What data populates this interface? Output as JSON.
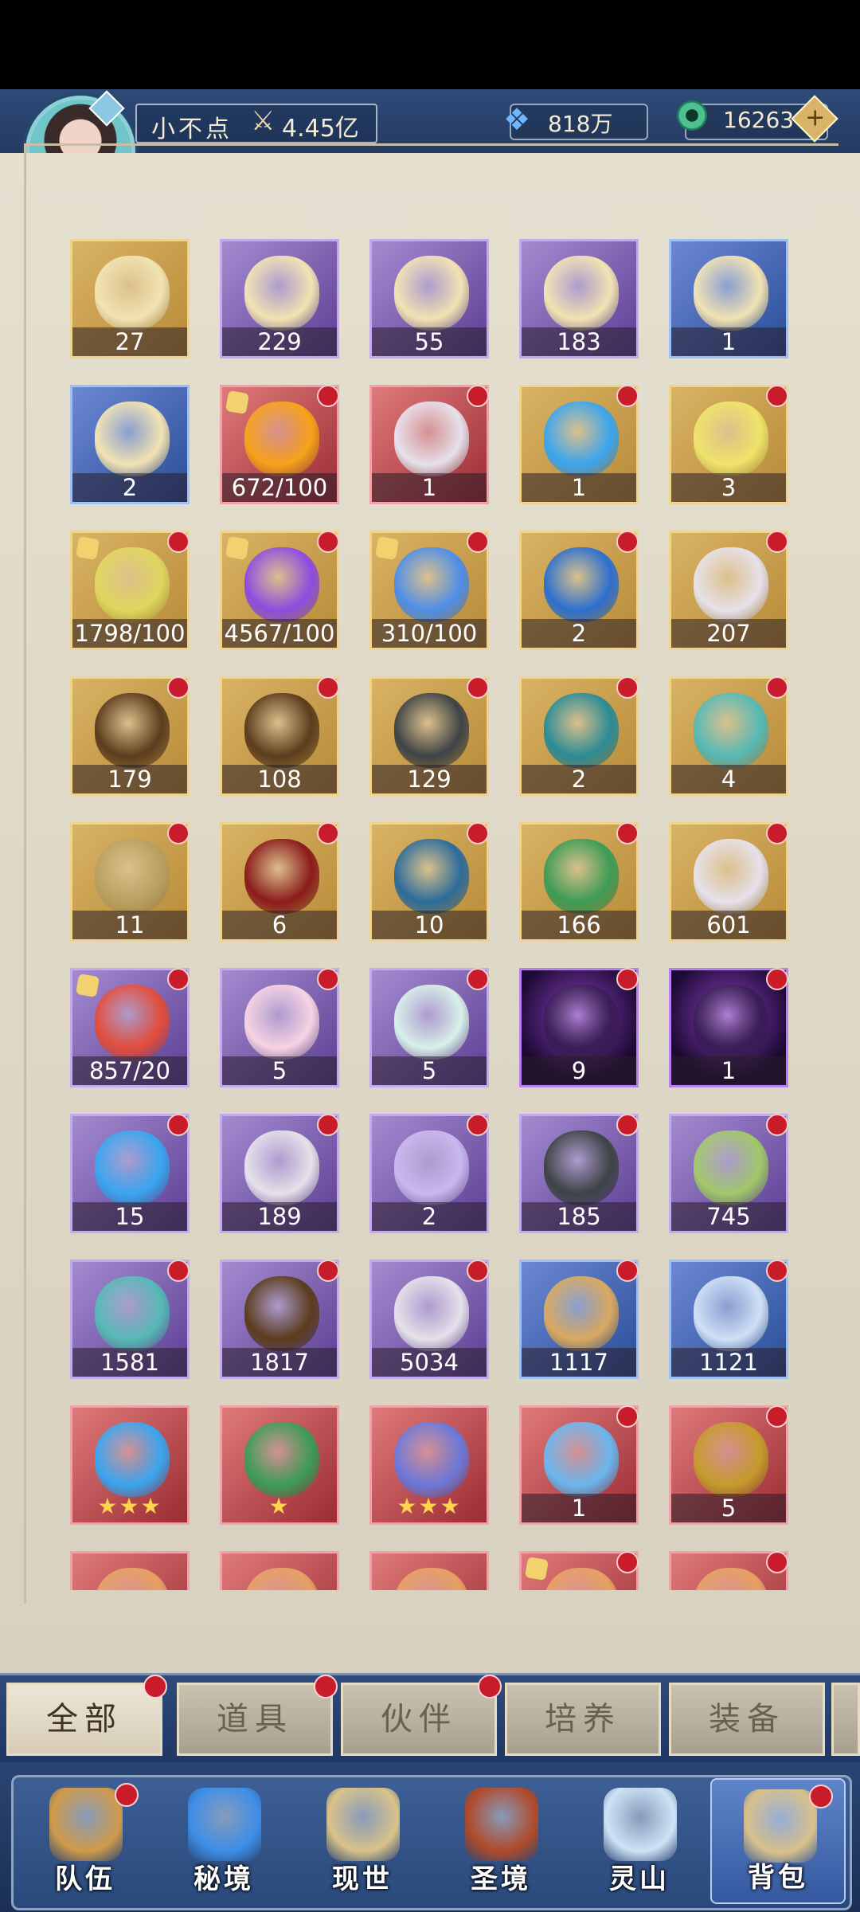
{
  "header": {
    "player_name": "小不点",
    "power_value": "4.45亿",
    "resource_1_value": "818万",
    "resource_2_value": "16263",
    "plus_symbol": "+"
  },
  "inventory": {
    "rows": [
      [
        {
          "count": "27",
          "style": "gold",
          "art": "#f2e3b3",
          "dot": false,
          "piece": false
        },
        {
          "count": "229",
          "style": "purple",
          "art": "#f2e3b3",
          "dot": false,
          "piece": false
        },
        {
          "count": "55",
          "style": "purple",
          "art": "#f2e3b3",
          "dot": false,
          "piece": false
        },
        {
          "count": "183",
          "style": "purple",
          "art": "#f2e3b3",
          "dot": false,
          "piece": false
        },
        {
          "count": "1",
          "style": "blue",
          "art": "#f2e3b3",
          "dot": false,
          "piece": false
        }
      ],
      [
        {
          "count": "2",
          "style": "blue",
          "art": "#f2e3b3",
          "dot": false,
          "piece": false
        },
        {
          "count": "672/100",
          "style": "red",
          "art": "#f6a21a",
          "dot": true,
          "piece": true
        },
        {
          "count": "1",
          "style": "red",
          "art": "#e6e1ea",
          "dot": true,
          "piece": false
        },
        {
          "count": "1",
          "style": "gold",
          "art": "#3aa5ef",
          "dot": true,
          "piece": false
        },
        {
          "count": "3",
          "style": "gold",
          "art": "#efe36a",
          "dot": true,
          "piece": false
        }
      ],
      [
        {
          "count": "1798/100",
          "style": "gold",
          "art": "#e0d65e",
          "dot": true,
          "piece": true
        },
        {
          "count": "4567/100",
          "style": "gold",
          "art": "#8e4ce0",
          "dot": true,
          "piece": true
        },
        {
          "count": "310/100",
          "style": "gold",
          "art": "#4e8ee8",
          "dot": true,
          "piece": true
        },
        {
          "count": "2",
          "style": "gold",
          "art": "#2c70cf",
          "dot": true,
          "piece": false
        },
        {
          "count": "207",
          "style": "gold",
          "art": "#e6e1ea",
          "dot": true,
          "piece": false
        }
      ],
      [
        {
          "count": "179",
          "style": "gold",
          "art": "#5b3c1d",
          "dot": true,
          "piece": false
        },
        {
          "count": "108",
          "style": "gold",
          "art": "#5b3c1d",
          "dot": true,
          "piece": false
        },
        {
          "count": "129",
          "style": "gold",
          "art": "#3e4346",
          "dot": true,
          "piece": false
        },
        {
          "count": "2",
          "style": "gold",
          "art": "#2b8b96",
          "dot": true,
          "piece": false
        },
        {
          "count": "4",
          "style": "gold",
          "art": "#56b9b6",
          "dot": true,
          "piece": false
        }
      ],
      [
        {
          "count": "11",
          "style": "gold",
          "art": "#b9a061",
          "dot": true,
          "piece": false
        },
        {
          "count": "6",
          "style": "gold",
          "art": "#8b1b1b",
          "dot": true,
          "piece": false
        },
        {
          "count": "10",
          "style": "gold",
          "art": "#2c6c9b",
          "dot": true,
          "piece": false
        },
        {
          "count": "166",
          "style": "gold",
          "art": "#3c9c55",
          "dot": true,
          "piece": false
        },
        {
          "count": "601",
          "style": "gold",
          "art": "#e6e1ea",
          "dot": true,
          "piece": false
        }
      ],
      [
        {
          "count": "857/20",
          "style": "purple",
          "art": "#e24d3b",
          "dot": true,
          "piece": true
        },
        {
          "count": "5",
          "style": "purple",
          "art": "#f7d3e3",
          "dot": true,
          "piece": false
        },
        {
          "count": "5",
          "style": "purple",
          "art": "#d8f0ea",
          "dot": true,
          "piece": false
        },
        {
          "count": "9",
          "style": "dark",
          "art": "#3b1d59",
          "dot": true,
          "piece": false
        },
        {
          "count": "1",
          "style": "dark",
          "art": "#3b1d59",
          "dot": true,
          "piece": false
        }
      ],
      [
        {
          "count": "15",
          "style": "purple",
          "art": "#3aa5ef",
          "dot": true,
          "piece": false
        },
        {
          "count": "189",
          "style": "purple",
          "art": "#e6e1ea",
          "dot": true,
          "piece": false
        },
        {
          "count": "2",
          "style": "purple",
          "art": "#c9b7ef",
          "dot": true,
          "piece": false
        },
        {
          "count": "185",
          "style": "purple",
          "art": "#3e4346",
          "dot": true,
          "piece": false
        },
        {
          "count": "745",
          "style": "purple",
          "art": "#a2c86a",
          "dot": true,
          "piece": false
        }
      ],
      [
        {
          "count": "1581",
          "style": "purple",
          "art": "#56b9b6",
          "dot": true,
          "piece": false
        },
        {
          "count": "1817",
          "style": "purple",
          "art": "#5b3c1d",
          "dot": true,
          "piece": false
        },
        {
          "count": "5034",
          "style": "purple",
          "art": "#e6e1ea",
          "dot": true,
          "piece": false
        },
        {
          "count": "1117",
          "style": "blue",
          "art": "#d9a95f",
          "dot": true,
          "piece": false
        },
        {
          "count": "1121",
          "style": "blue",
          "art": "#cfe0f6",
          "dot": true,
          "piece": false
        }
      ],
      [
        {
          "count": "",
          "stars": "★★★",
          "style": "red",
          "art": "#3aa5ef",
          "dot": false,
          "piece": false
        },
        {
          "count": "",
          "stars": "★",
          "style": "red",
          "art": "#3c9c55",
          "dot": false,
          "piece": false
        },
        {
          "count": "",
          "stars": "★★★",
          "style": "red",
          "art": "#6c78d8",
          "dot": false,
          "piece": false
        },
        {
          "count": "1",
          "style": "red",
          "art": "#6ab6ef",
          "dot": true,
          "piece": false
        },
        {
          "count": "5",
          "style": "red",
          "art": "#c59b2c",
          "dot": true,
          "piece": false
        }
      ],
      [
        {
          "count": "",
          "style": "red",
          "art": "#e7a062",
          "dot": false,
          "piece": false
        },
        {
          "count": "",
          "style": "red",
          "art": "#e7a062",
          "dot": false,
          "piece": false
        },
        {
          "count": "",
          "style": "red",
          "art": "#e7a062",
          "dot": false,
          "piece": false
        },
        {
          "count": "",
          "style": "red",
          "art": "#e7a062",
          "dot": true,
          "piece": true
        },
        {
          "count": "",
          "style": "red",
          "art": "#e7a062",
          "dot": true,
          "piece": false
        }
      ]
    ]
  },
  "tabs": [
    {
      "label": "全部",
      "active": true,
      "dot": true
    },
    {
      "label": "道具",
      "active": false,
      "dot": true
    },
    {
      "label": "伙伴",
      "active": false,
      "dot": true
    },
    {
      "label": "培养",
      "active": false,
      "dot": false
    },
    {
      "label": "装备",
      "active": false,
      "dot": false
    }
  ],
  "nav": [
    {
      "label": "队伍",
      "icon": "#d09a4a",
      "active": false,
      "dot": true
    },
    {
      "label": "秘境",
      "icon": "#3d8ee8",
      "active": false,
      "dot": false
    },
    {
      "label": "现世",
      "icon": "#d9c28a",
      "active": false,
      "dot": false
    },
    {
      "label": "圣境",
      "icon": "#b04a2a",
      "active": false,
      "dot": false
    },
    {
      "label": "灵山",
      "icon": "#cfe3f6",
      "active": false,
      "dot": false
    },
    {
      "label": "背包",
      "icon": "#d8c08a",
      "active": true,
      "dot": true
    }
  ]
}
